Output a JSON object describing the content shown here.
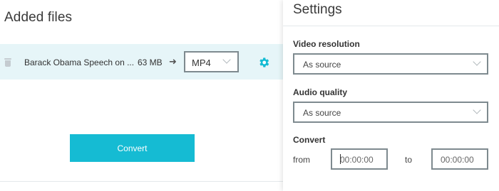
{
  "left": {
    "title": "Added files",
    "file": {
      "name": "Barack Obama Speech on ...",
      "size": "63 MB",
      "arrow": "➜",
      "format": "MP4"
    },
    "convert_label": "Convert"
  },
  "settings": {
    "title": "Settings",
    "video_resolution_label": "Video resolution",
    "video_resolution_value": "As source",
    "audio_quality_label": "Audio quality",
    "audio_quality_value": "As source",
    "convert_label": "Convert",
    "from_label": "from",
    "from_value": "00:00:00",
    "to_label": "to",
    "to_value": "00:00:00"
  },
  "colors": {
    "accent": "#15bbd3",
    "row_highlight": "#e6f5f8",
    "border": "#7e8a8f"
  },
  "icons": [
    "trash-icon",
    "arrow-right-icon",
    "chevron-down-icon",
    "gear-icon"
  ]
}
